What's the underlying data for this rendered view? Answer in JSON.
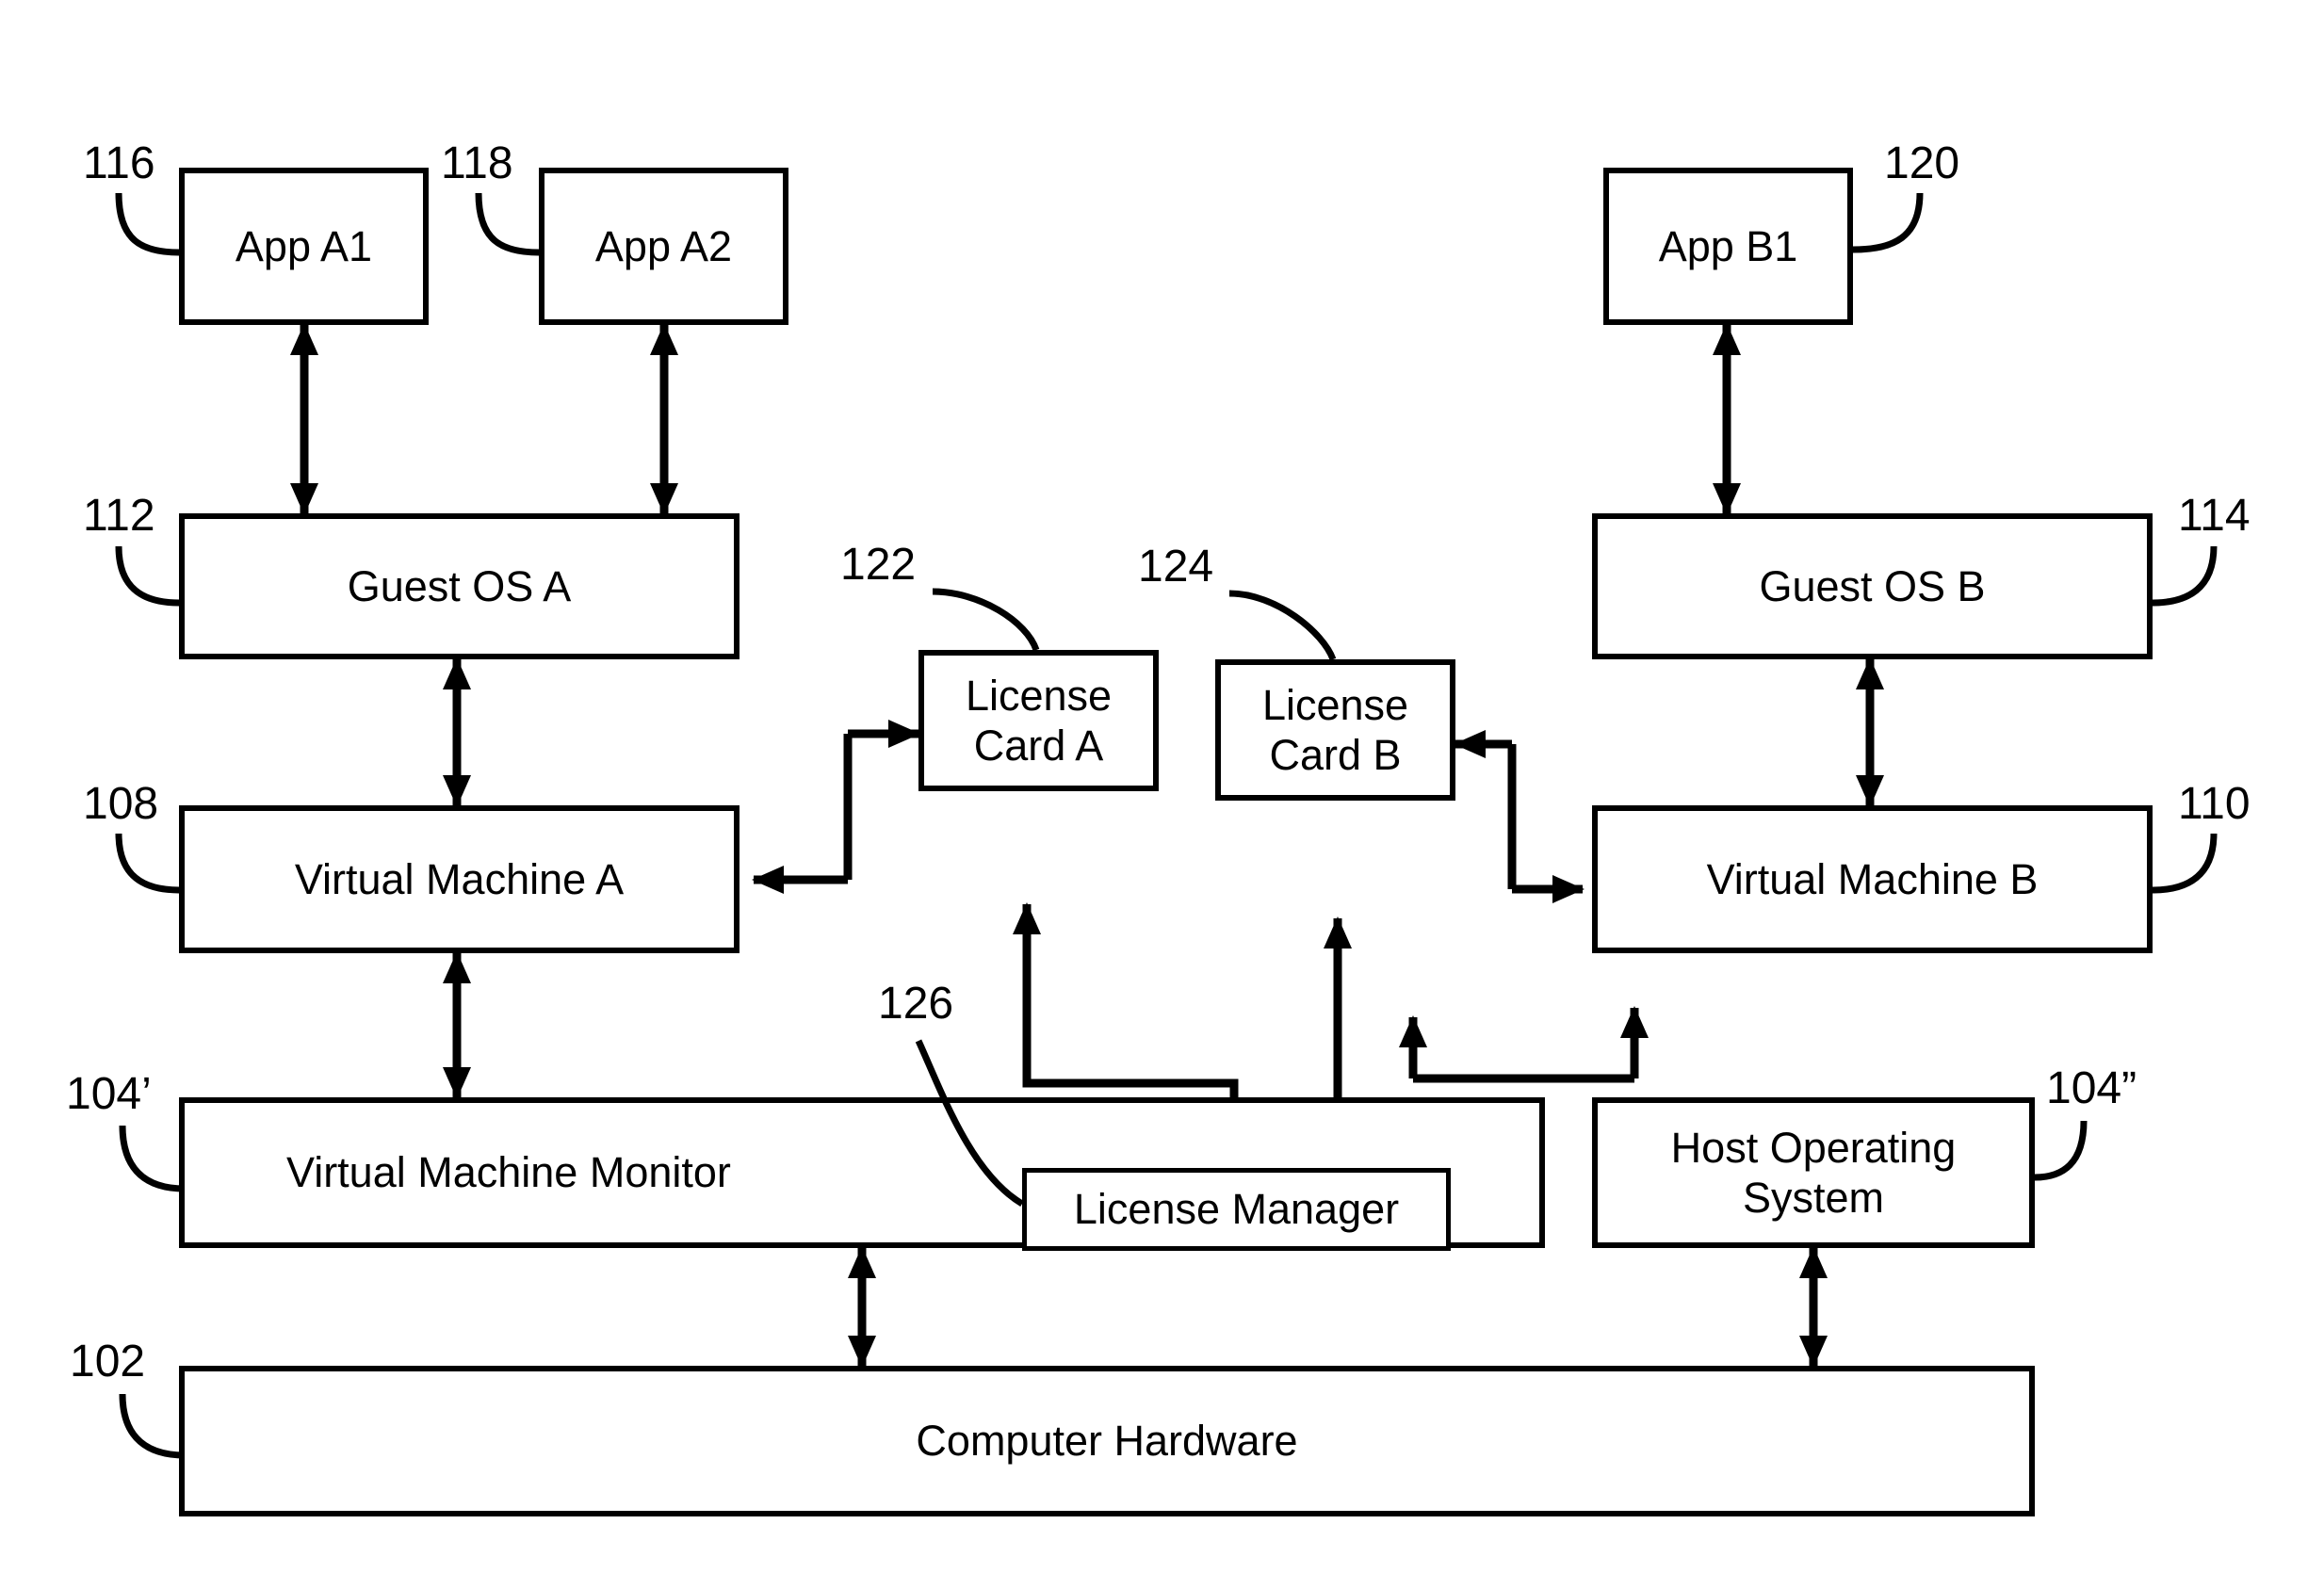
{
  "figure": {
    "type": "patent-block-diagram",
    "title": "Virtual machine licensing architecture",
    "background_color": "#ffffff",
    "line_color": "#000000"
  },
  "blocks": [
    {
      "id": "app_a1",
      "label": "App A1",
      "ref": "116"
    },
    {
      "id": "app_a2",
      "label": "App A2",
      "ref": "118"
    },
    {
      "id": "app_b1",
      "label": "App B1",
      "ref": "120"
    },
    {
      "id": "guest_os_a",
      "label": "Guest OS A",
      "ref": "112"
    },
    {
      "id": "guest_os_b",
      "label": "Guest OS B",
      "ref": "114"
    },
    {
      "id": "license_card_a",
      "label": "License\nCard A",
      "ref": "122"
    },
    {
      "id": "license_card_b",
      "label": "License\nCard B",
      "ref": "124"
    },
    {
      "id": "virtual_machine_a",
      "label": "Virtual Machine A",
      "ref": "108"
    },
    {
      "id": "virtual_machine_b",
      "label": "Virtual Machine B",
      "ref": "110"
    },
    {
      "id": "virtual_machine_monitor",
      "label": "Virtual Machine Monitor",
      "ref": "104'"
    },
    {
      "id": "license_manager",
      "label": "License Manager",
      "ref": "126"
    },
    {
      "id": "host_operating_system",
      "label": "Host Operating\nSystem",
      "ref": "104”"
    },
    {
      "id": "computer_hardware",
      "label": "Computer Hardware",
      "ref": "102"
    }
  ],
  "labels": {
    "app_a1": "App A1",
    "app_a2": "App A2",
    "app_b1": "App B1",
    "guest_os_a": "Guest OS A",
    "guest_os_b": "Guest OS B",
    "license_card_a_line1": "License",
    "license_card_a_line2": "Card A",
    "license_card_b_line1": "License",
    "license_card_b_line2": "Card B",
    "virtual_machine_a": "Virtual Machine A",
    "virtual_machine_b": "Virtual Machine B",
    "virtual_machine_monitor": "Virtual Machine Monitor",
    "license_manager": "License Manager",
    "host_operating_system_line1": "Host Operating",
    "host_operating_system_line2": "System",
    "computer_hardware": "Computer Hardware"
  },
  "refs": {
    "app_a1": "116",
    "app_a2": "118",
    "app_b1": "120",
    "guest_os_a": "112",
    "guest_os_b": "114",
    "license_card_a": "122",
    "license_card_b": "124",
    "virtual_machine_a": "108",
    "virtual_machine_b": "110",
    "virtual_machine_monitor": "104’",
    "license_manager": "126",
    "host_operating_system": "104”",
    "computer_hardware": "102"
  },
  "connections": [
    {
      "from": "app_a1",
      "to": "guest_os_a",
      "style": "double-arrow-vertical"
    },
    {
      "from": "app_a2",
      "to": "guest_os_a",
      "style": "double-arrow-vertical"
    },
    {
      "from": "app_b1",
      "to": "guest_os_b",
      "style": "double-arrow-vertical"
    },
    {
      "from": "guest_os_a",
      "to": "virtual_machine_a",
      "style": "double-arrow-vertical"
    },
    {
      "from": "guest_os_b",
      "to": "virtual_machine_b",
      "style": "double-arrow-vertical"
    },
    {
      "from": "virtual_machine_a",
      "to": "virtual_machine_monitor",
      "style": "double-arrow-vertical"
    },
    {
      "from": "virtual_machine_monitor",
      "to": "computer_hardware",
      "style": "double-arrow-vertical"
    },
    {
      "from": "host_operating_system",
      "to": "computer_hardware",
      "style": "double-arrow-vertical"
    },
    {
      "from": "virtual_machine_a",
      "to": "license_card_a",
      "style": "s-shaped-double-arrow"
    },
    {
      "from": "license_card_b",
      "to": "virtual_machine_b",
      "style": "s-shaped-double-arrow"
    },
    {
      "from": "license_card_a",
      "to": "license_manager",
      "style": "elbow-double-arrow"
    },
    {
      "from": "license_card_b",
      "to": "license_manager",
      "style": "straight-double-arrow"
    },
    {
      "from": "virtual_machine_monitor",
      "to": "virtual_machine_b",
      "style": "elbow-arrow-up"
    }
  ]
}
